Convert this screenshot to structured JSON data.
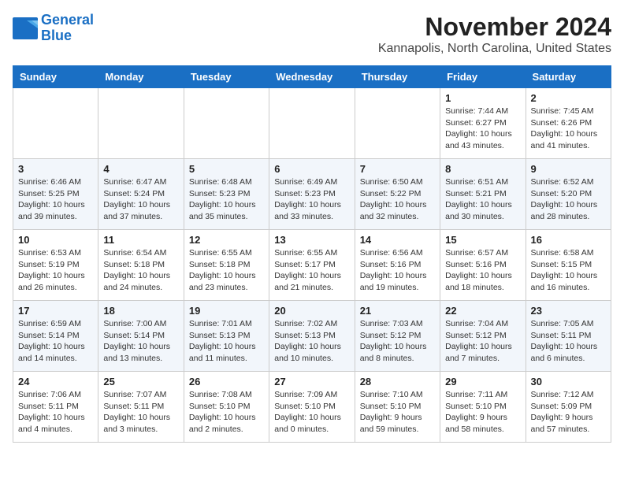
{
  "logo": {
    "line1": "General",
    "line2": "Blue"
  },
  "title": "November 2024",
  "subtitle": "Kannapolis, North Carolina, United States",
  "days_of_week": [
    "Sunday",
    "Monday",
    "Tuesday",
    "Wednesday",
    "Thursday",
    "Friday",
    "Saturday"
  ],
  "weeks": [
    [
      {
        "day": "",
        "info": ""
      },
      {
        "day": "",
        "info": ""
      },
      {
        "day": "",
        "info": ""
      },
      {
        "day": "",
        "info": ""
      },
      {
        "day": "",
        "info": ""
      },
      {
        "day": "1",
        "info": "Sunrise: 7:44 AM\nSunset: 6:27 PM\nDaylight: 10 hours\nand 43 minutes."
      },
      {
        "day": "2",
        "info": "Sunrise: 7:45 AM\nSunset: 6:26 PM\nDaylight: 10 hours\nand 41 minutes."
      }
    ],
    [
      {
        "day": "3",
        "info": "Sunrise: 6:46 AM\nSunset: 5:25 PM\nDaylight: 10 hours\nand 39 minutes."
      },
      {
        "day": "4",
        "info": "Sunrise: 6:47 AM\nSunset: 5:24 PM\nDaylight: 10 hours\nand 37 minutes."
      },
      {
        "day": "5",
        "info": "Sunrise: 6:48 AM\nSunset: 5:23 PM\nDaylight: 10 hours\nand 35 minutes."
      },
      {
        "day": "6",
        "info": "Sunrise: 6:49 AM\nSunset: 5:23 PM\nDaylight: 10 hours\nand 33 minutes."
      },
      {
        "day": "7",
        "info": "Sunrise: 6:50 AM\nSunset: 5:22 PM\nDaylight: 10 hours\nand 32 minutes."
      },
      {
        "day": "8",
        "info": "Sunrise: 6:51 AM\nSunset: 5:21 PM\nDaylight: 10 hours\nand 30 minutes."
      },
      {
        "day": "9",
        "info": "Sunrise: 6:52 AM\nSunset: 5:20 PM\nDaylight: 10 hours\nand 28 minutes."
      }
    ],
    [
      {
        "day": "10",
        "info": "Sunrise: 6:53 AM\nSunset: 5:19 PM\nDaylight: 10 hours\nand 26 minutes."
      },
      {
        "day": "11",
        "info": "Sunrise: 6:54 AM\nSunset: 5:18 PM\nDaylight: 10 hours\nand 24 minutes."
      },
      {
        "day": "12",
        "info": "Sunrise: 6:55 AM\nSunset: 5:18 PM\nDaylight: 10 hours\nand 23 minutes."
      },
      {
        "day": "13",
        "info": "Sunrise: 6:55 AM\nSunset: 5:17 PM\nDaylight: 10 hours\nand 21 minutes."
      },
      {
        "day": "14",
        "info": "Sunrise: 6:56 AM\nSunset: 5:16 PM\nDaylight: 10 hours\nand 19 minutes."
      },
      {
        "day": "15",
        "info": "Sunrise: 6:57 AM\nSunset: 5:16 PM\nDaylight: 10 hours\nand 18 minutes."
      },
      {
        "day": "16",
        "info": "Sunrise: 6:58 AM\nSunset: 5:15 PM\nDaylight: 10 hours\nand 16 minutes."
      }
    ],
    [
      {
        "day": "17",
        "info": "Sunrise: 6:59 AM\nSunset: 5:14 PM\nDaylight: 10 hours\nand 14 minutes."
      },
      {
        "day": "18",
        "info": "Sunrise: 7:00 AM\nSunset: 5:14 PM\nDaylight: 10 hours\nand 13 minutes."
      },
      {
        "day": "19",
        "info": "Sunrise: 7:01 AM\nSunset: 5:13 PM\nDaylight: 10 hours\nand 11 minutes."
      },
      {
        "day": "20",
        "info": "Sunrise: 7:02 AM\nSunset: 5:13 PM\nDaylight: 10 hours\nand 10 minutes."
      },
      {
        "day": "21",
        "info": "Sunrise: 7:03 AM\nSunset: 5:12 PM\nDaylight: 10 hours\nand 8 minutes."
      },
      {
        "day": "22",
        "info": "Sunrise: 7:04 AM\nSunset: 5:12 PM\nDaylight: 10 hours\nand 7 minutes."
      },
      {
        "day": "23",
        "info": "Sunrise: 7:05 AM\nSunset: 5:11 PM\nDaylight: 10 hours\nand 6 minutes."
      }
    ],
    [
      {
        "day": "24",
        "info": "Sunrise: 7:06 AM\nSunset: 5:11 PM\nDaylight: 10 hours\nand 4 minutes."
      },
      {
        "day": "25",
        "info": "Sunrise: 7:07 AM\nSunset: 5:11 PM\nDaylight: 10 hours\nand 3 minutes."
      },
      {
        "day": "26",
        "info": "Sunrise: 7:08 AM\nSunset: 5:10 PM\nDaylight: 10 hours\nand 2 minutes."
      },
      {
        "day": "27",
        "info": "Sunrise: 7:09 AM\nSunset: 5:10 PM\nDaylight: 10 hours\nand 0 minutes."
      },
      {
        "day": "28",
        "info": "Sunrise: 7:10 AM\nSunset: 5:10 PM\nDaylight: 9 hours\nand 59 minutes."
      },
      {
        "day": "29",
        "info": "Sunrise: 7:11 AM\nSunset: 5:10 PM\nDaylight: 9 hours\nand 58 minutes."
      },
      {
        "day": "30",
        "info": "Sunrise: 7:12 AM\nSunset: 5:09 PM\nDaylight: 9 hours\nand 57 minutes."
      }
    ]
  ]
}
